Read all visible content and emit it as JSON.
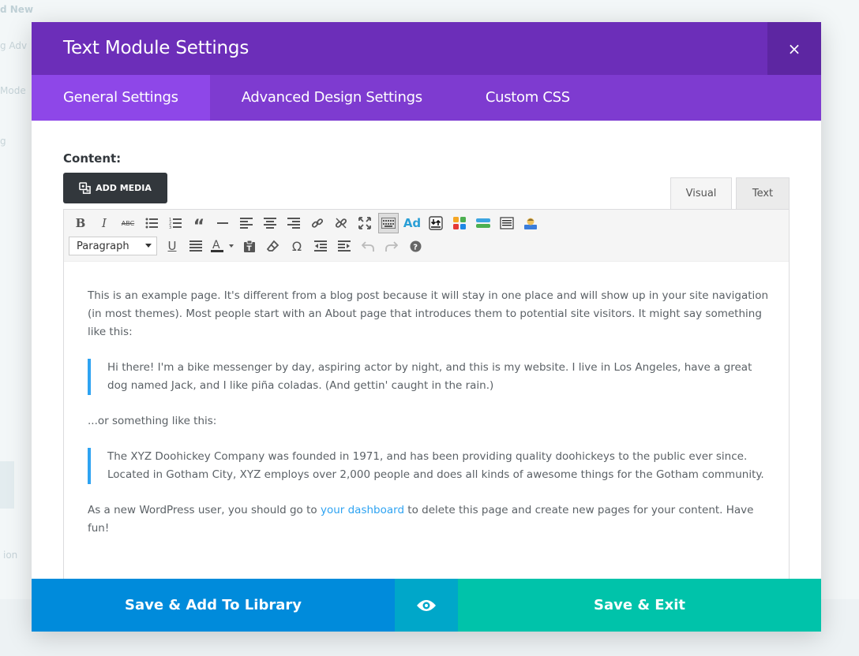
{
  "background": {
    "fragments": [
      "d New",
      "g Adv",
      "Mode",
      "g",
      "ion"
    ]
  },
  "modal": {
    "title": "Text Module Settings",
    "close_glyph": "×",
    "tabs": [
      {
        "label": "General Settings",
        "active": true
      },
      {
        "label": "Advanced Design Settings",
        "active": false
      },
      {
        "label": "Custom CSS",
        "active": false
      }
    ]
  },
  "content": {
    "label": "Content:",
    "add_media_label": "ADD MEDIA",
    "mode_tabs": {
      "visual": "Visual",
      "text": "Text"
    }
  },
  "toolbar": {
    "row1_icons": [
      "bold-icon",
      "italic-icon",
      "strikethrough-icon",
      "bullet-list-icon",
      "numbered-list-icon",
      "blockquote-icon",
      "horizontal-rule-icon",
      "align-left-icon",
      "align-center-icon",
      "align-right-icon",
      "link-icon",
      "unlink-icon",
      "fullscreen-icon",
      "toolbar-toggle-icon",
      "ad-icon",
      "insert-shortcode-icon",
      "color-grid-icon",
      "layout-icon",
      "list-box-icon",
      "user-icon"
    ],
    "format_select": "Paragraph",
    "row2_icons": [
      "underline-icon",
      "justify-icon",
      "text-color-icon",
      "paste-text-icon",
      "clear-formatting-icon",
      "special-character-icon",
      "outdent-icon",
      "indent-icon",
      "undo-icon",
      "redo-icon",
      "help-icon"
    ],
    "ad_label": "Ad"
  },
  "editor": {
    "para1": "This is an example page. It's different from a blog post because it will stay in one place and will show up in your site navigation (in most themes). Most people start with an About page that introduces them to potential site visitors. It might say something like this:",
    "quote1": "Hi there! I'm a bike messenger by day, aspiring actor by night, and this is my website. I live in Los Angeles, have a great dog named Jack, and I like piña coladas. (And gettin' caught in the rain.)",
    "para2": "...or something like this:",
    "quote2": "The XYZ Doohickey Company was founded in 1971, and has been providing quality doohickeys to the public ever since. Located in Gotham City, XYZ employs over 2,000 people and does all kinds of awesome things for the Gotham community.",
    "para3_before": "As a new WordPress user, you should go to ",
    "para3_link": "your dashboard",
    "para3_after": " to delete this page and create new pages for your content. Have fun!"
  },
  "footer": {
    "library_label": "Save & Add To Library",
    "exit_label": "Save & Exit"
  },
  "colors": {
    "header": "#6c2eb9",
    "tabs": "#7e3bd0",
    "active_tab": "#8e47e8",
    "library_button": "#008bdb",
    "preview_button": "#00a7c9",
    "exit_button": "#00c3aa",
    "quote_border": "#2ea3f2"
  }
}
